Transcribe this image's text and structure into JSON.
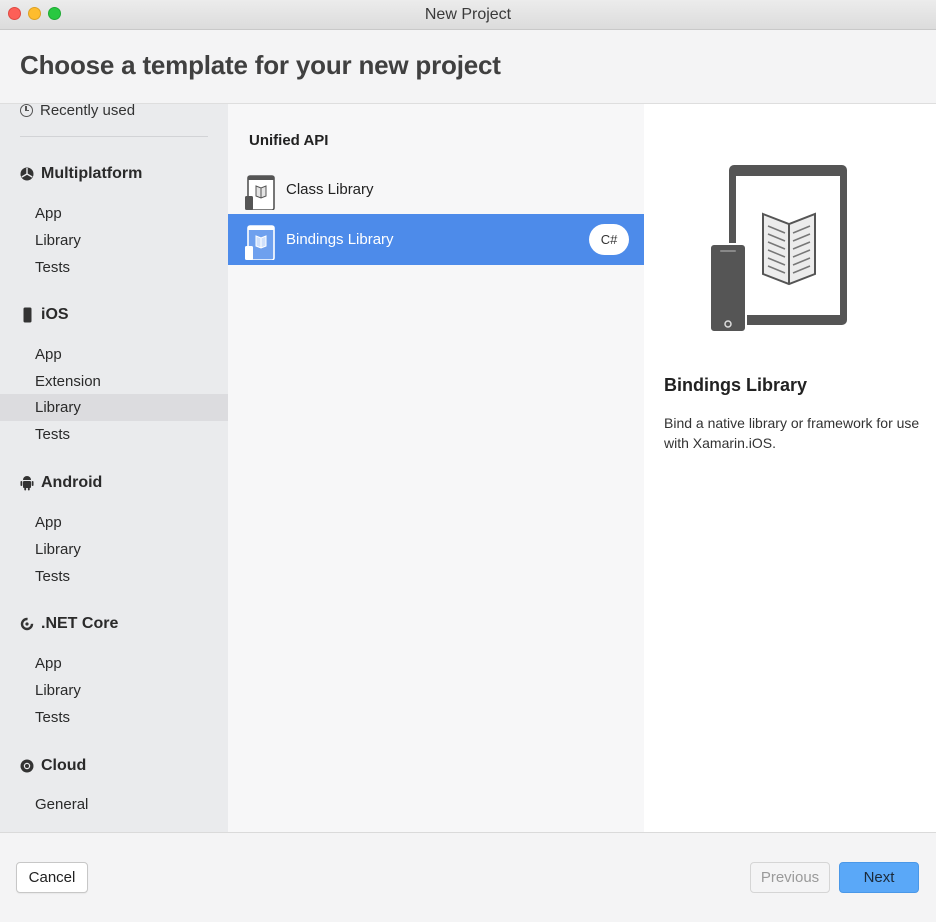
{
  "window": {
    "title": "New Project"
  },
  "header": {
    "title": "Choose a template for your new project"
  },
  "sidebar": {
    "recent": "Recently used",
    "categories": [
      {
        "name": "Multiplatform",
        "icon": "multiplatform-icon",
        "items": [
          "App",
          "Library",
          "Tests"
        ]
      },
      {
        "name": "iOS",
        "icon": "phone-icon",
        "items": [
          "App",
          "Extension",
          "Library",
          "Tests"
        ]
      },
      {
        "name": "Android",
        "icon": "android-icon",
        "items": [
          "App",
          "Library",
          "Tests"
        ]
      },
      {
        "name": ".NET Core",
        "icon": "dotnet-core-icon",
        "items": [
          "App",
          "Library",
          "Tests"
        ]
      },
      {
        "name": "Cloud",
        "icon": "cloud-icon",
        "items": [
          "General"
        ]
      }
    ],
    "selected": "iOS / Library"
  },
  "templates": {
    "group": "Unified API",
    "items": [
      {
        "label": "Class Library"
      },
      {
        "label": "Bindings Library",
        "badge": "C#"
      }
    ],
    "selected": "Bindings Library"
  },
  "detail": {
    "title": "Bindings Library",
    "description": "Bind a native library or framework for use with Xamarin.iOS."
  },
  "footer": {
    "cancel": "Cancel",
    "previous": "Previous",
    "next": "Next"
  },
  "colors": {
    "selection": "#4d8bea",
    "primary_button": "#5aa8f8",
    "sidebar_bg": "#eaebed",
    "list_bg": "#f7f7f8"
  }
}
